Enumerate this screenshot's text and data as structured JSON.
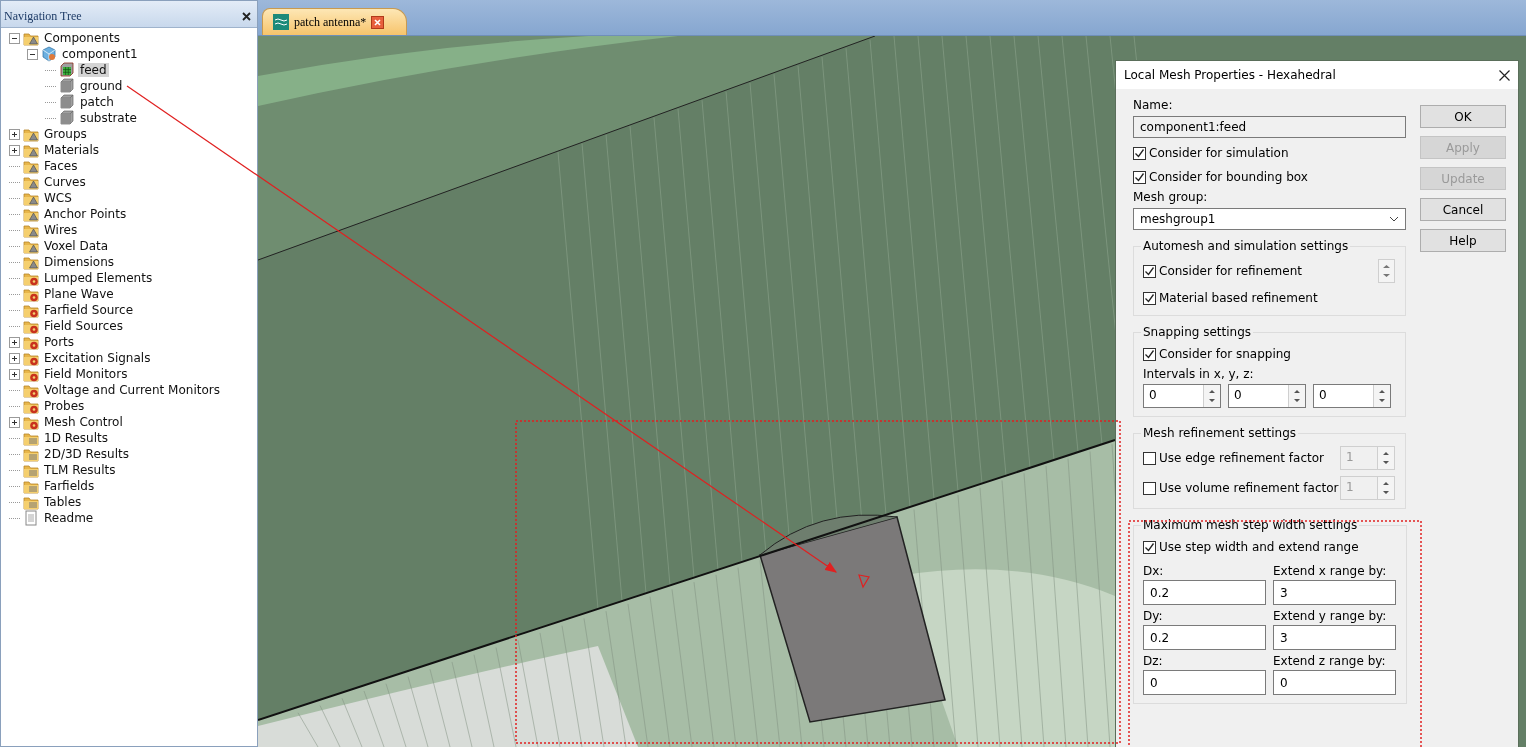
{
  "tree_panel": {
    "title": "Navigation Tree",
    "items": [
      {
        "label": "Components",
        "kind": "folder-alert",
        "expanded": true,
        "selected": false,
        "children": [
          {
            "label": "component1",
            "kind": "component",
            "expanded": true,
            "selected": false,
            "children": [
              {
                "label": "feed",
                "kind": "solid-mesh",
                "selected": true
              },
              {
                "label": "ground",
                "kind": "solid",
                "selected": false
              },
              {
                "label": "patch",
                "kind": "solid",
                "selected": false
              },
              {
                "label": "substrate",
                "kind": "solid",
                "selected": false
              }
            ]
          }
        ]
      },
      {
        "label": "Groups",
        "kind": "folder-alert",
        "expanded": false,
        "selected": false
      },
      {
        "label": "Materials",
        "kind": "folder-alert",
        "expanded": false,
        "selected": false
      },
      {
        "label": "Faces",
        "kind": "folder-alert",
        "selected": false
      },
      {
        "label": "Curves",
        "kind": "folder-alert",
        "selected": false
      },
      {
        "label": "WCS",
        "kind": "folder-alert",
        "selected": false
      },
      {
        "label": "Anchor Points",
        "kind": "folder-alert",
        "selected": false
      },
      {
        "label": "Wires",
        "kind": "folder-alert",
        "selected": false
      },
      {
        "label": "Voxel Data",
        "kind": "folder-alert",
        "selected": false
      },
      {
        "label": "Dimensions",
        "kind": "folder-alert",
        "selected": false
      },
      {
        "label": "Lumped Elements",
        "kind": "folder-gear",
        "selected": false
      },
      {
        "label": "Plane Wave",
        "kind": "folder-gear",
        "selected": false
      },
      {
        "label": "Farfield Source",
        "kind": "folder-gear",
        "selected": false
      },
      {
        "label": "Field Sources",
        "kind": "folder-gear",
        "selected": false
      },
      {
        "label": "Ports",
        "kind": "folder-gear",
        "expanded": false,
        "selected": false
      },
      {
        "label": "Excitation Signals",
        "kind": "folder-gear",
        "expanded": false,
        "selected": false
      },
      {
        "label": "Field Monitors",
        "kind": "folder-gear",
        "expanded": false,
        "selected": false
      },
      {
        "label": "Voltage and Current Monitors",
        "kind": "folder-gear",
        "selected": false
      },
      {
        "label": "Probes",
        "kind": "folder-gear",
        "selected": false
      },
      {
        "label": "Mesh Control",
        "kind": "folder-gear",
        "expanded": false,
        "selected": false
      },
      {
        "label": "1D Results",
        "kind": "folder-layers",
        "selected": false
      },
      {
        "label": "2D/3D Results",
        "kind": "folder-layers",
        "selected": false
      },
      {
        "label": "TLM Results",
        "kind": "folder-layers",
        "selected": false
      },
      {
        "label": "Farfields",
        "kind": "folder-layers",
        "selected": false
      },
      {
        "label": "Tables",
        "kind": "folder-layers",
        "selected": false
      },
      {
        "label": "Readme",
        "kind": "document",
        "selected": false
      }
    ]
  },
  "document_tab": {
    "label": "patch antenna*",
    "selected": true
  },
  "dialog": {
    "title": "Local Mesh Properties - Hexahedral",
    "buttons": [
      {
        "label": "OK",
        "disabled": false
      },
      {
        "label": "Apply",
        "disabled": true
      },
      {
        "label": "Update",
        "disabled": true
      },
      {
        "label": "Cancel",
        "disabled": false
      },
      {
        "label": "Help",
        "disabled": false
      }
    ],
    "name_label": "Name:",
    "name_value": "component1:feed",
    "checkboxes": [
      {
        "label": "Consider for simulation",
        "checked": true
      },
      {
        "label": "Consider for bounding box",
        "checked": true
      }
    ],
    "mesh_group_label": "Mesh group:",
    "mesh_group_value": "meshgroup1",
    "groups": [
      {
        "title": "Automesh and simulation settings",
        "rows": [
          {
            "kind": "checkbox-spinner",
            "label": "Consider for refinement",
            "checked": true
          },
          {
            "kind": "checkbox",
            "label": "Material based refinement",
            "checked": true
          }
        ]
      },
      {
        "title": "Snapping settings",
        "rows": [
          {
            "kind": "checkbox",
            "label": "Consider for snapping",
            "checked": true
          },
          {
            "kind": "label",
            "text": "Intervals in x, y, z:"
          },
          {
            "kind": "spin-fields",
            "fields": [
              {
                "value": "0"
              },
              {
                "value": "0"
              },
              {
                "value": "0"
              }
            ]
          }
        ]
      },
      {
        "title": "Mesh refinement settings",
        "rows": [
          {
            "kind": "checkbox-spin",
            "label": "Use edge refinement factor",
            "checked": false,
            "value": "1",
            "disabled": true
          },
          {
            "kind": "checkbox-spin",
            "label": "Use volume refinement factor",
            "checked": false,
            "value": "1",
            "disabled": true
          }
        ]
      },
      {
        "title": "Maximum mesh step width settings",
        "rows": [
          {
            "kind": "checkbox",
            "label": "Use step width and extend range",
            "checked": true
          },
          {
            "kind": "field-grid",
            "fields": [
              {
                "label": "Dx:",
                "value": "0.2"
              },
              {
                "label": "Extend x range by:",
                "value": "3"
              },
              {
                "label": "Dy:",
                "value": "0.2"
              },
              {
                "label": "Extend y range by:",
                "value": "3"
              },
              {
                "label": "Dz:",
                "value": "0"
              },
              {
                "label": "Extend z range by:",
                "value": "0"
              }
            ]
          }
        ]
      }
    ]
  }
}
